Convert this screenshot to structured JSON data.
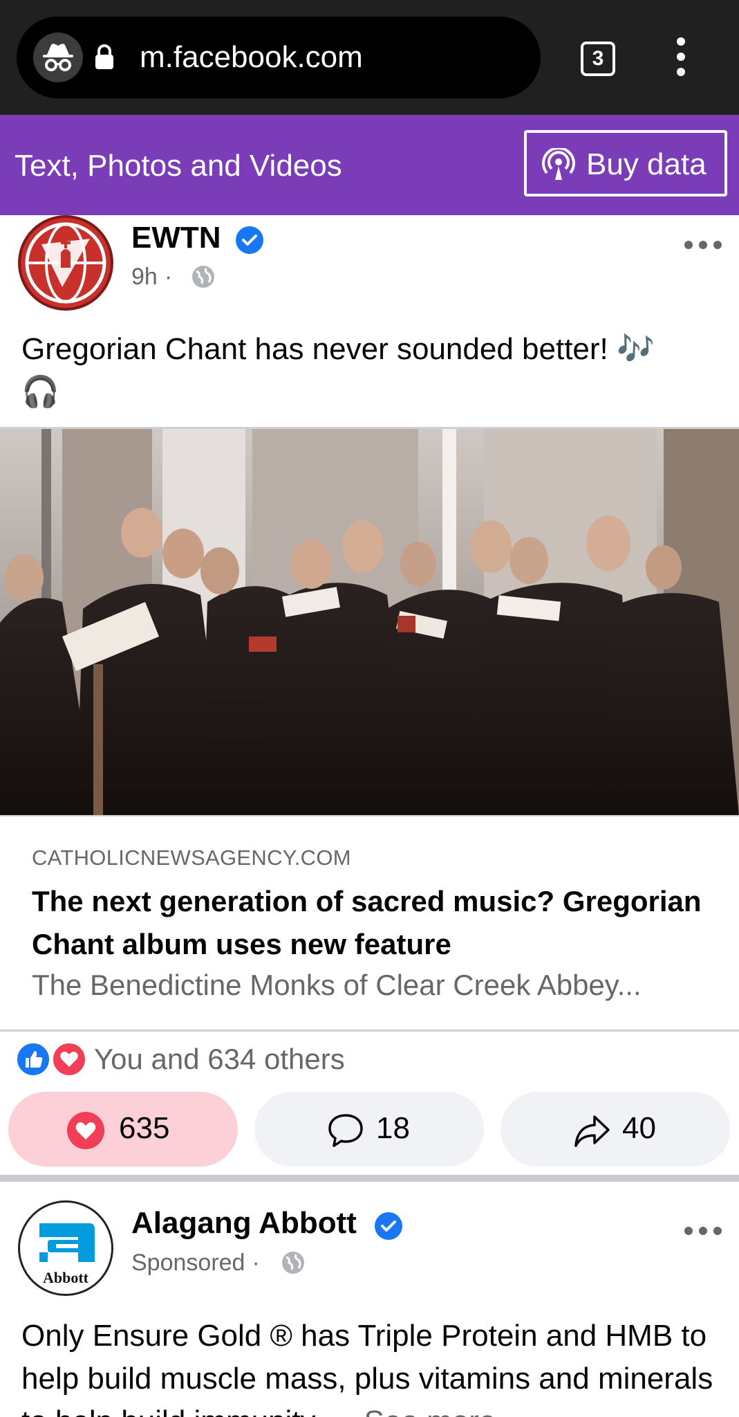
{
  "browser": {
    "url": "m.facebook.com",
    "tab_count": "3"
  },
  "banner": {
    "text": "Text, Photos and Videos",
    "buy_label": "Buy data",
    "color": "#7b3cb7"
  },
  "post1": {
    "page_name": "EWTN",
    "time": "9h",
    "separator": "·",
    "text": "Gregorian Chant has never sounded better!",
    "emoji_notes": "🎶",
    "emoji_headphones": "🎧",
    "link": {
      "domain": "CATHOLICNEWSAGENCY.COM",
      "title": "The next generation of sacred music? Gregorian Chant album uses new feature",
      "description": "The Benedictine Monks of Clear Creek Abbey..."
    },
    "reactions_text": "You and 634 others",
    "like_count": "635",
    "comment_count": "18",
    "share_count": "40"
  },
  "post2": {
    "page_name": "Alagang Abbott",
    "meta": "Sponsored",
    "separator": "·",
    "logo_text": "Abbott",
    "text": "Only Ensure Gold ® has Triple Protein and HMB to help build muscle mass, plus vitamins and minerals to help build immunity.",
    "see_more": "... See more"
  },
  "icons": {
    "incognito": "incognito-icon",
    "lock": "lock-icon",
    "tabs": "tabs-icon",
    "menu": "kebab-menu-icon",
    "buy": "broadcast-icon",
    "verified": "verified-badge-icon",
    "globe": "globe-icon",
    "more": "more-horizontal-icon",
    "like": "like-icon",
    "love": "love-icon",
    "comment": "comment-icon",
    "share": "share-icon"
  },
  "colors": {
    "facebook_blue": "#1877f2",
    "love_red": "#f33e58",
    "liked_bg": "#fcd0d6",
    "button_bg": "#f0f2f5",
    "secondary_text": "#65676b"
  }
}
